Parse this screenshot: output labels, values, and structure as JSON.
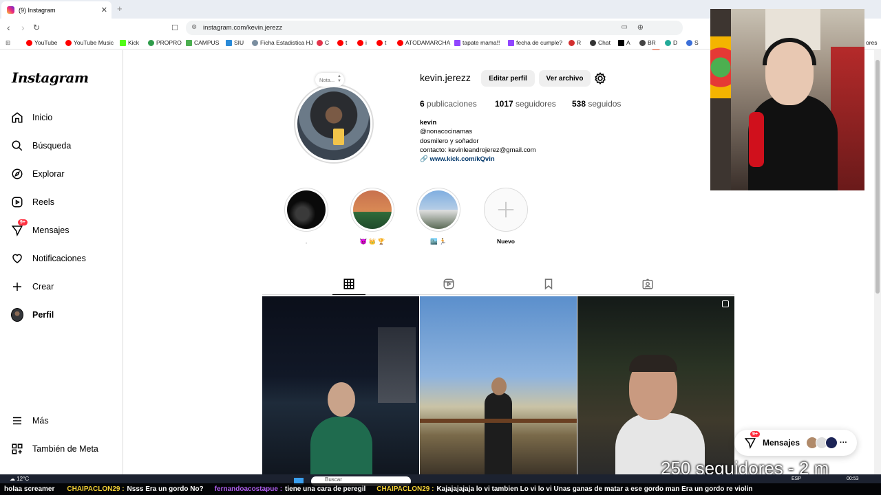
{
  "browser": {
    "tab_title": "(9) Instagram",
    "url": "instagram.com/kevin.jerezz",
    "bookmarks": [
      "YouTube",
      "YouTube Music",
      "Kick",
      "PROPRO",
      "CAMPUS",
      "SIU",
      "Ficha Estadistica HJ",
      "C",
      "t",
      "i",
      "t",
      "ATODAMARCHA",
      "tapate mama!!",
      "fecha de cumple?",
      "R",
      "Chat",
      "A",
      "BR",
      "D",
      "S",
      "ores"
    ]
  },
  "sidebar": {
    "logo": "Instagram",
    "items": [
      {
        "label": "Inicio",
        "icon": "home-icon"
      },
      {
        "label": "Búsqueda",
        "icon": "search-icon"
      },
      {
        "label": "Explorar",
        "icon": "compass-icon"
      },
      {
        "label": "Reels",
        "icon": "reels-icon"
      },
      {
        "label": "Mensajes",
        "icon": "messenger-icon",
        "badge": "9+"
      },
      {
        "label": "Notificaciones",
        "icon": "heart-icon"
      },
      {
        "label": "Crear",
        "icon": "plus-icon"
      },
      {
        "label": "Perfil",
        "icon": "avatar-icon"
      }
    ],
    "more": "Más",
    "meta": "También de Meta"
  },
  "profile": {
    "note": "Nota...",
    "username": "kevin.jerezz",
    "edit_button": "Editar perfil",
    "archive_button": "Ver archivo",
    "stats": [
      {
        "count": "6",
        "label": "publicaciones"
      },
      {
        "count": "1017",
        "label": "seguidores"
      },
      {
        "count": "538",
        "label": "seguidos"
      }
    ],
    "name": "kevin",
    "handle": "@nonacocinamas",
    "bio1": "dosmilero y soñador",
    "bio2": "contacto: kevinleandrojerez@gmail.com",
    "link": "www.kick.com/kQvin"
  },
  "highlights": [
    {
      "label": "."
    },
    {
      "label": "😈 👑 🏆"
    },
    {
      "label": "🏙️ 🏃"
    },
    {
      "label": "Nuevo"
    }
  ],
  "messages_pill": {
    "label": "Mensajes",
    "badge": "9+"
  },
  "overlay": {
    "followers_text": "250 seguidores - 2 m"
  },
  "taskbar": {
    "weather": "12°C",
    "search": "Buscar",
    "lang": "ESP",
    "time": "00:53"
  },
  "ticker": [
    {
      "user": "",
      "msg": "holaa screamer"
    },
    {
      "user": "CHAIPACLON29 :",
      "msg": "Nsss  Era un gordo  No?"
    },
    {
      "user": "fernandoacostapue :",
      "msg": "tiene una cara de peregil"
    },
    {
      "user": "CHAIPACLON29 :",
      "msg": "Kajajajajaja lo vi tambien  Lo vi lo vi  Unas ganas de matar a ese gordo man  Era un gordo re violin"
    }
  ]
}
